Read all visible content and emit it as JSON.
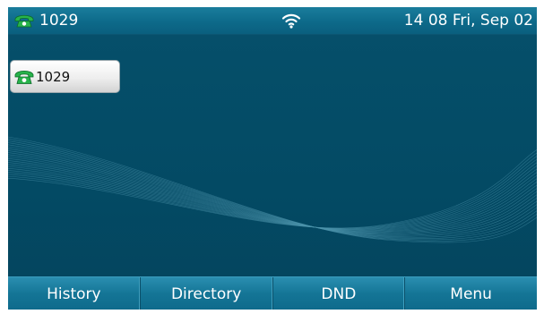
{
  "status_bar": {
    "account_icon": "phone-handset-icon",
    "account_label": "1029",
    "wifi_icon": "wifi-icon",
    "datetime": "14 08 Fri, Sep 02"
  },
  "line_keys": [
    {
      "icon": "phone-handset-icon",
      "label": "1029"
    }
  ],
  "softkeys": [
    {
      "label": "History"
    },
    {
      "label": "Directory"
    },
    {
      "label": "DND"
    },
    {
      "label": "Menu"
    }
  ],
  "colors": {
    "screen_background": "#034a64",
    "status_bar": "#0d6a8a",
    "softkey_bar": "#147596",
    "handset_green": "#27b34a",
    "line_key_background": "#eeeeee"
  }
}
